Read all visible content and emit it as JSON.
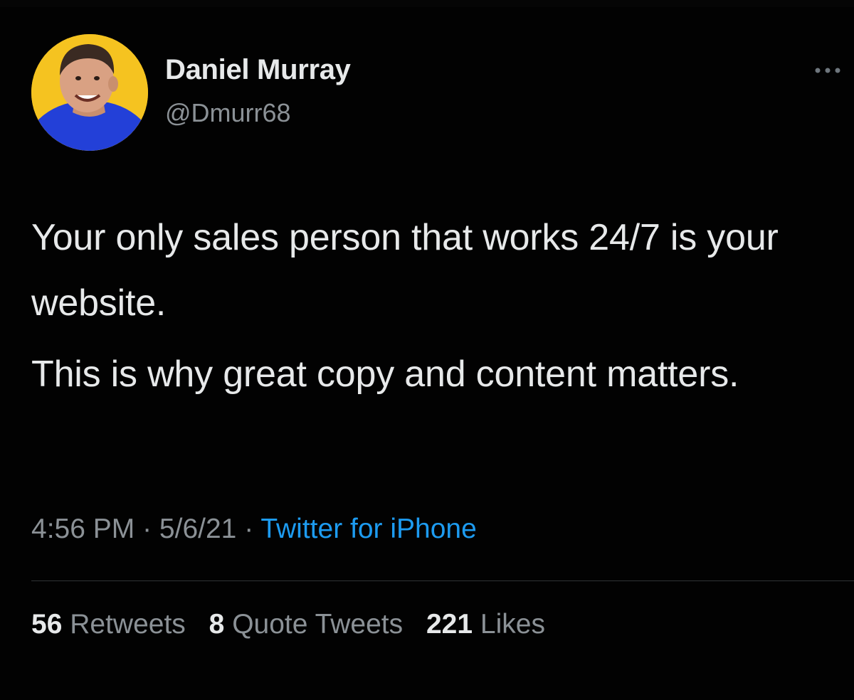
{
  "colors": {
    "background": "#020202",
    "text_primary": "#e7e9ea",
    "text_secondary": "#8b9196",
    "link": "#1d9bf0",
    "avatar_background": "#f5c320",
    "avatar_shirt": "#2340d8"
  },
  "author": {
    "name": "Daniel Murray",
    "handle": "@Dmurr68",
    "avatar_icon": "profile-photo"
  },
  "more_icon": "more-horizontal-icon",
  "tweet": {
    "paragraphs": [
      "Your only sales person that works 24/7 is your website.",
      "This is why great copy and content matters."
    ]
  },
  "meta": {
    "time": "4:56 PM",
    "separator": " · ",
    "date": "5/6/21",
    "source": "Twitter for iPhone"
  },
  "stats": {
    "retweets_count": "56",
    "retweets_label": "Retweets",
    "quotes_count": "8",
    "quotes_label": "Quote Tweets",
    "likes_count": "221",
    "likes_label": "Likes"
  }
}
